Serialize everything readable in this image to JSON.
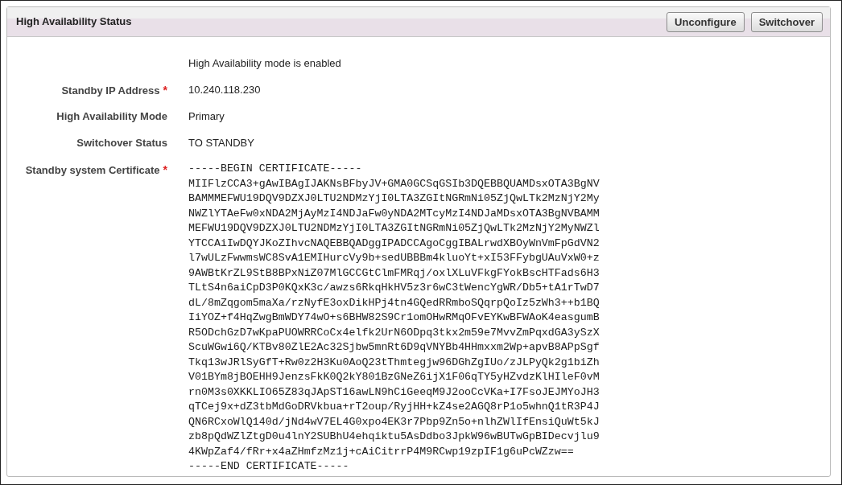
{
  "panel": {
    "title": "High Availability Status",
    "buttons": [
      "Unconfigure",
      "Switchover"
    ]
  },
  "notice": "High Availability mode is enabled",
  "fields": [
    {
      "kind": "text",
      "label": "Standby IP Address",
      "required": true,
      "value": "10.240.118.230"
    },
    {
      "kind": "text",
      "label": "High Availability Mode",
      "required": false,
      "value": "Primary"
    },
    {
      "kind": "text",
      "label": "Switchover Status",
      "required": false,
      "value": "TO STANDBY"
    },
    {
      "kind": "certificate",
      "label": "Standby system Certificate",
      "required": true,
      "lines": [
        "-----BEGIN CERTIFICATE-----",
        "MIIFlzCCA3+gAwIBAgIJAKNsBFbyJV+GMA0GCSqGSIb3DQEBBQUAMDsxOTA3BgNV",
        "BAMMMEFWU19DQV9DZXJ0LTU2NDMzYjI0LTA3ZGItNGRmNi05ZjQwLTk2MzNjY2My",
        "NWZlYTAeFw0xNDA2MjAyMzI4NDJaFw0yNDA2MTcyMzI4NDJaMDsxOTA3BgNVBAMM",
        "MEFWU19DQV9DZXJ0LTU2NDMzYjI0LTA3ZGItNGRmNi05ZjQwLTk2MzNjY2MyNWZl",
        "YTCCAiIwDQYJKoZIhvcNAQEBBQADggIPADCCAgoCggIBALrwdXBOyWnVmFpGdVN2",
        "l7wULzFwwmsWC8SvA1EMIHurcVy9b+sedUBBBm4kluoYt+xI53FFybgUAuVxW0+z",
        "9AWBtKrZL9StB8BPxNiZ07MlGCCGtClmFMRqj/oxlXLuVFkgFYokBscHTFads6H3",
        "TLtS4n6aiCpD3P0KQxK3c/awzs6RkqHkHV5z3r6wC3tWencYgWR/Db5+tA1rTwD7",
        "dL/8mZqgom5maXa/rzNyfE3oxDikHPj4tn4GQedRRmboSQqrpQoIz5zWh3++b1BQ",
        "IiYOZ+f4HqZwgBmWDY74wO+s6BHW82S9Cr1omOHwRMqOFvEYKwBFWAoK4easgumB",
        "R5ODchGzD7wKpaPUOWRRCoCx4elfk2UrN6ODpq3tkx2m59e7MvvZmPqxdGA3ySzX",
        "ScuWGwi6Q/KTBv80ZlE2Ac32Sjbw5mnRt6D9qVNYBb4HHmxxm2Wp+apvB8APpSgf",
        "Tkq13wJRlSyGfT+Rw0z2H3Ku0AoQ23tThmtegjw96DGhZgIUo/zJLPyQk2g1biZh",
        "V01BYm8jBOEHH9JenzsFkK0Q2kY801BzGNeZ6ijX1F06qTY5yHZvdzKlHIleF0vM",
        "rn0M3s0XKKLIO65Z83qJApST16awLN9hCiGeeqM9J2ooCcVKa+I7FsoJEJMYoJH3",
        "qTCej9x+dZ3tbMdGoDRVkbua+rT2oup/RyjHH+kZ4se2AGQ8rP1o5whnQ1tR3P4J",
        "QN6RCxoWlQ140d/jNd4wV7EL4G0xpo4EK3r7Pbp9Zn5o+nlhZWlIfEnsiQuWt5kJ",
        "zb8pQdWZlZtgD0u4lnY2SUBhU4ehqiktu5AsDdbo3JpkW96wBUTwGpBIDecvjlu9",
        "4KWpZaf4/fRr+x4aZHmfzMz1j+cAiCitrrP4M9RCwp19zpIF1g6uPcWZzw==",
        "-----END CERTIFICATE-----"
      ]
    }
  ],
  "required_mark": "*"
}
